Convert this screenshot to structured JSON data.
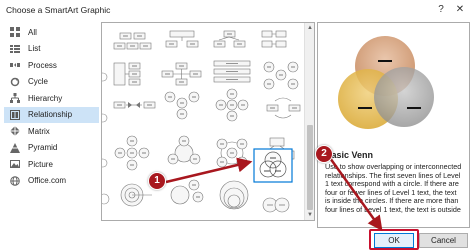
{
  "window": {
    "title": "Choose a SmartArt Graphic",
    "help_glyph": "?",
    "close_glyph": "✕"
  },
  "categories": [
    {
      "label": "All",
      "icon": "all-icon"
    },
    {
      "label": "List",
      "icon": "list-icon"
    },
    {
      "label": "Process",
      "icon": "process-icon"
    },
    {
      "label": "Cycle",
      "icon": "cycle-icon"
    },
    {
      "label": "Hierarchy",
      "icon": "hierarchy-icon"
    },
    {
      "label": "Relationship",
      "icon": "relationship-icon",
      "selected": true
    },
    {
      "label": "Matrix",
      "icon": "matrix-icon"
    },
    {
      "label": "Pyramid",
      "icon": "pyramid-icon"
    },
    {
      "label": "Picture",
      "icon": "picture-icon"
    },
    {
      "label": "Office.com",
      "icon": "office-icon"
    }
  ],
  "preview": {
    "name": "Basic Venn",
    "description": "Use to show overlapping or interconnected relationships. The first seven lines of Level 1 text correspond with a circle. If there are four or fewer lines of Level 1 text, the text is inside the circles. If there are more than four lines of Level 1 text, the text is outside"
  },
  "buttons": {
    "ok": "OK",
    "cancel": "Cancel"
  },
  "annotations": {
    "step1": "1",
    "step2": "2",
    "color": "#a8171e"
  },
  "colors": {
    "selected_category": "#cde3f7",
    "selected_layout_border": "#0078d7",
    "venn_top": "#d9a47e",
    "venn_left": "#e5b94c",
    "venn_right": "#a3a3a3"
  }
}
